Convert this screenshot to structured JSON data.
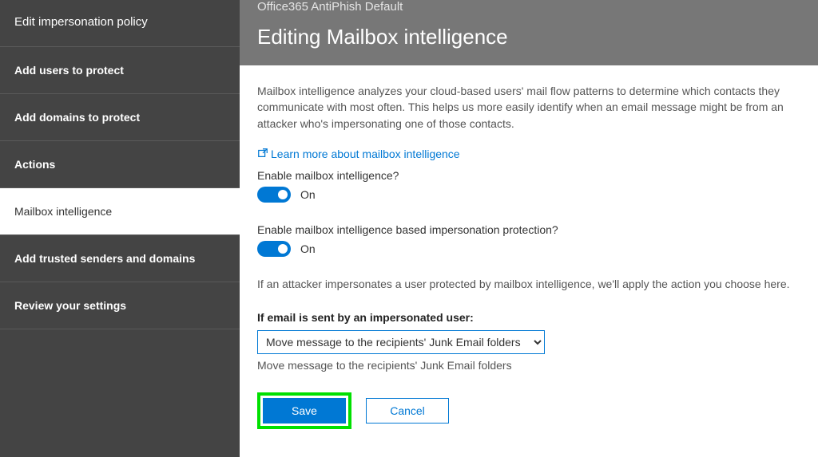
{
  "sidebar": {
    "title": "Edit impersonation policy",
    "items": [
      {
        "label": "Add users to protect"
      },
      {
        "label": "Add domains to protect"
      },
      {
        "label": "Actions"
      },
      {
        "label": "Mailbox intelligence"
      },
      {
        "label": "Add trusted senders and domains"
      },
      {
        "label": "Review your settings"
      }
    ]
  },
  "header": {
    "subtitle": "Office365 AntiPhish Default",
    "title": "Editing Mailbox intelligence"
  },
  "content": {
    "description": "Mailbox intelligence analyzes your cloud-based users' mail flow patterns to determine which contacts they communicate with most often. This helps us more easily identify when an email message might be from an attacker who's impersonating one of those contacts.",
    "learn_more": "Learn more about mailbox intelligence",
    "q1_label": "Enable mailbox intelligence?",
    "q1_state": "On",
    "q2_label": "Enable mailbox intelligence based impersonation protection?",
    "q2_state": "On",
    "info": "If an attacker impersonates a user protected by mailbox intelligence, we'll apply the action you choose here.",
    "field_label": "If email is sent by an impersonated user:",
    "select_value": "Move message to the recipients' Junk Email folders",
    "hint": "Move message to the recipients' Junk Email folders",
    "save": "Save",
    "cancel": "Cancel"
  }
}
